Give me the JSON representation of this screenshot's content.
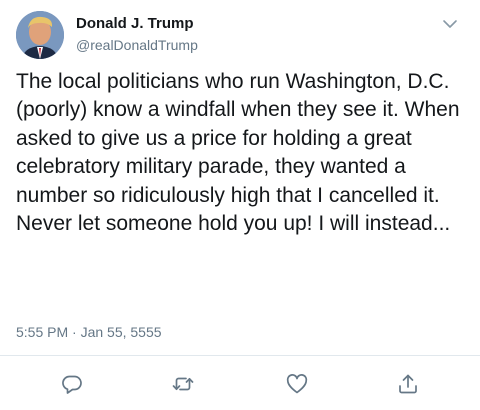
{
  "author": {
    "name": "Donald J. Trump",
    "handle": "@realDonaldTrump"
  },
  "tweet": {
    "text": "The local politicians who run Washington, D.C. (poorly) know a windfall when they see it. When asked to give us a price for holding a great celebratory military parade, they wanted a number so ridiculously high that I cancelled it. Never let someone hold you up! I will instead...",
    "timestamp": "5:55 PM · Jan 55, 5555"
  },
  "icons": {
    "menu": "chevron-down-icon",
    "reply": "reply-icon",
    "retweet": "retweet-icon",
    "like": "heart-icon",
    "share": "share-icon"
  },
  "colors": {
    "text": "#14171a",
    "secondary": "#657786",
    "divider": "#e1e8ed"
  }
}
